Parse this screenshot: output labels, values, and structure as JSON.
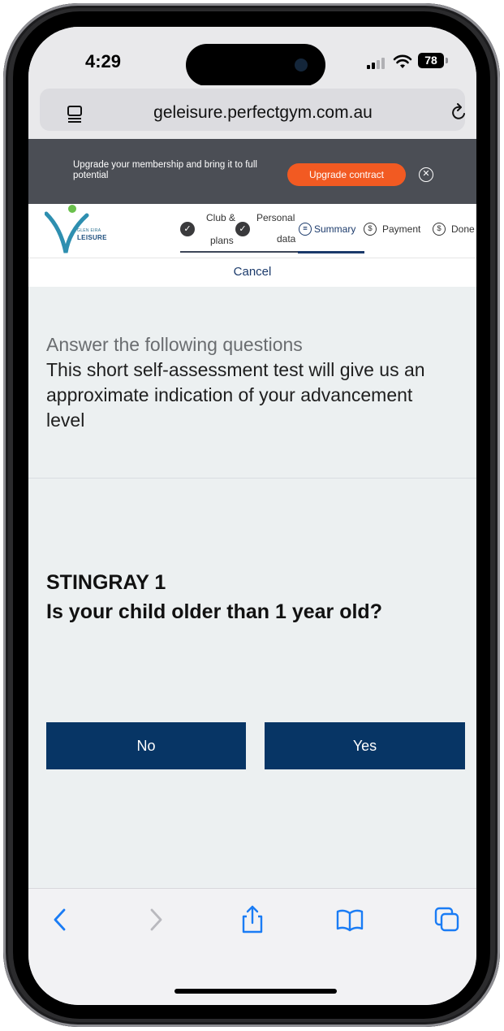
{
  "status_bar": {
    "time": "4:29",
    "battery": "78"
  },
  "browser": {
    "url": "geleisure.perfectgym.com.au"
  },
  "banner": {
    "text": "Upgrade your membership and bring it to full potential",
    "button_label": "Upgrade contract",
    "close_icon": "close-circle-icon",
    "button_color": "#f25a22"
  },
  "header": {
    "logo": {
      "line1": "GLEN EIRA",
      "line2": "LEISURE"
    },
    "steps": [
      {
        "line1": "Club &",
        "line2": "plans",
        "icon": "check",
        "status": "done"
      },
      {
        "line1": "Personal",
        "line2": "data",
        "icon": "check",
        "status": "done"
      },
      {
        "label": "Summary",
        "icon": "list",
        "status": "current"
      },
      {
        "label": "Payment",
        "icon": "dollar",
        "status": "pending"
      },
      {
        "label": "Done",
        "icon": "dollar",
        "status": "pending"
      }
    ],
    "cancel_label": "Cancel"
  },
  "assessment": {
    "title": "Answer the following questions",
    "description": "This short self-assessment test will give us an approximate indication of your advancement level",
    "group": "STINGRAY 1",
    "question": "Is your child older than 1 year old?",
    "answers": [
      "No",
      "Yes"
    ],
    "answer_color": "#073565"
  },
  "toolbar": {
    "items": [
      "back-icon",
      "forward-icon",
      "share-icon",
      "bookmarks-icon",
      "tabs-icon"
    ]
  }
}
